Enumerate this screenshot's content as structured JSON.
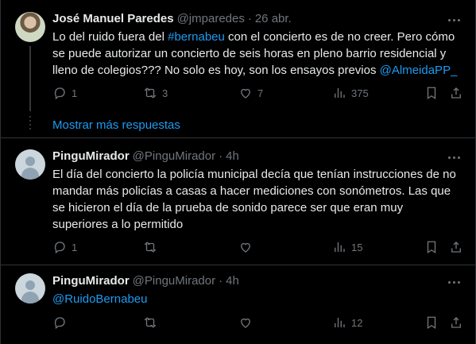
{
  "tweets": [
    {
      "name": "José Manuel Paredes",
      "handle": "@jmparedes",
      "sep": "·",
      "time": "26 abr.",
      "text_parts": [
        {
          "t": "Lo del ruido fuera del ",
          "link": false
        },
        {
          "t": "#bernabeu",
          "link": true
        },
        {
          "t": " con el concierto es de no creer. Pero cómo se puede autorizar un concierto de seis horas en pleno barrio residencial y lleno de colegios??? No solo es hoy, son los ensayos previos ",
          "link": false
        },
        {
          "t": "@AlmeidaPP_",
          "link": true
        }
      ],
      "replies": "1",
      "retweets": "3",
      "likes": "7",
      "views": "375"
    },
    {
      "name": "PinguMirador",
      "handle": "@PinguMirador",
      "sep": "·",
      "time": "4h",
      "text_parts": [
        {
          "t": "El día del concierto la policía municipal decía que tenían instrucciones de no mandar más policías a casas a hacer mediciones con sonómetros. Las que se hicieron el día de la prueba de sonido parece ser que eran muy superiores a lo permitido",
          "link": false
        }
      ],
      "replies": "1",
      "retweets": "",
      "likes": "",
      "views": "15"
    },
    {
      "name": "PinguMirador",
      "handle": "@PinguMirador",
      "sep": "·",
      "time": "4h",
      "text_parts": [
        {
          "t": "@RuidoBernabeu",
          "link": true
        }
      ],
      "replies": "",
      "retweets": "",
      "likes": "",
      "views": "12"
    }
  ],
  "show_more_label": "Mostrar más respuestas",
  "colors": {
    "link": "#1d9bf0",
    "muted": "#71767b",
    "text": "#e7e9ea",
    "background": "#000000"
  }
}
